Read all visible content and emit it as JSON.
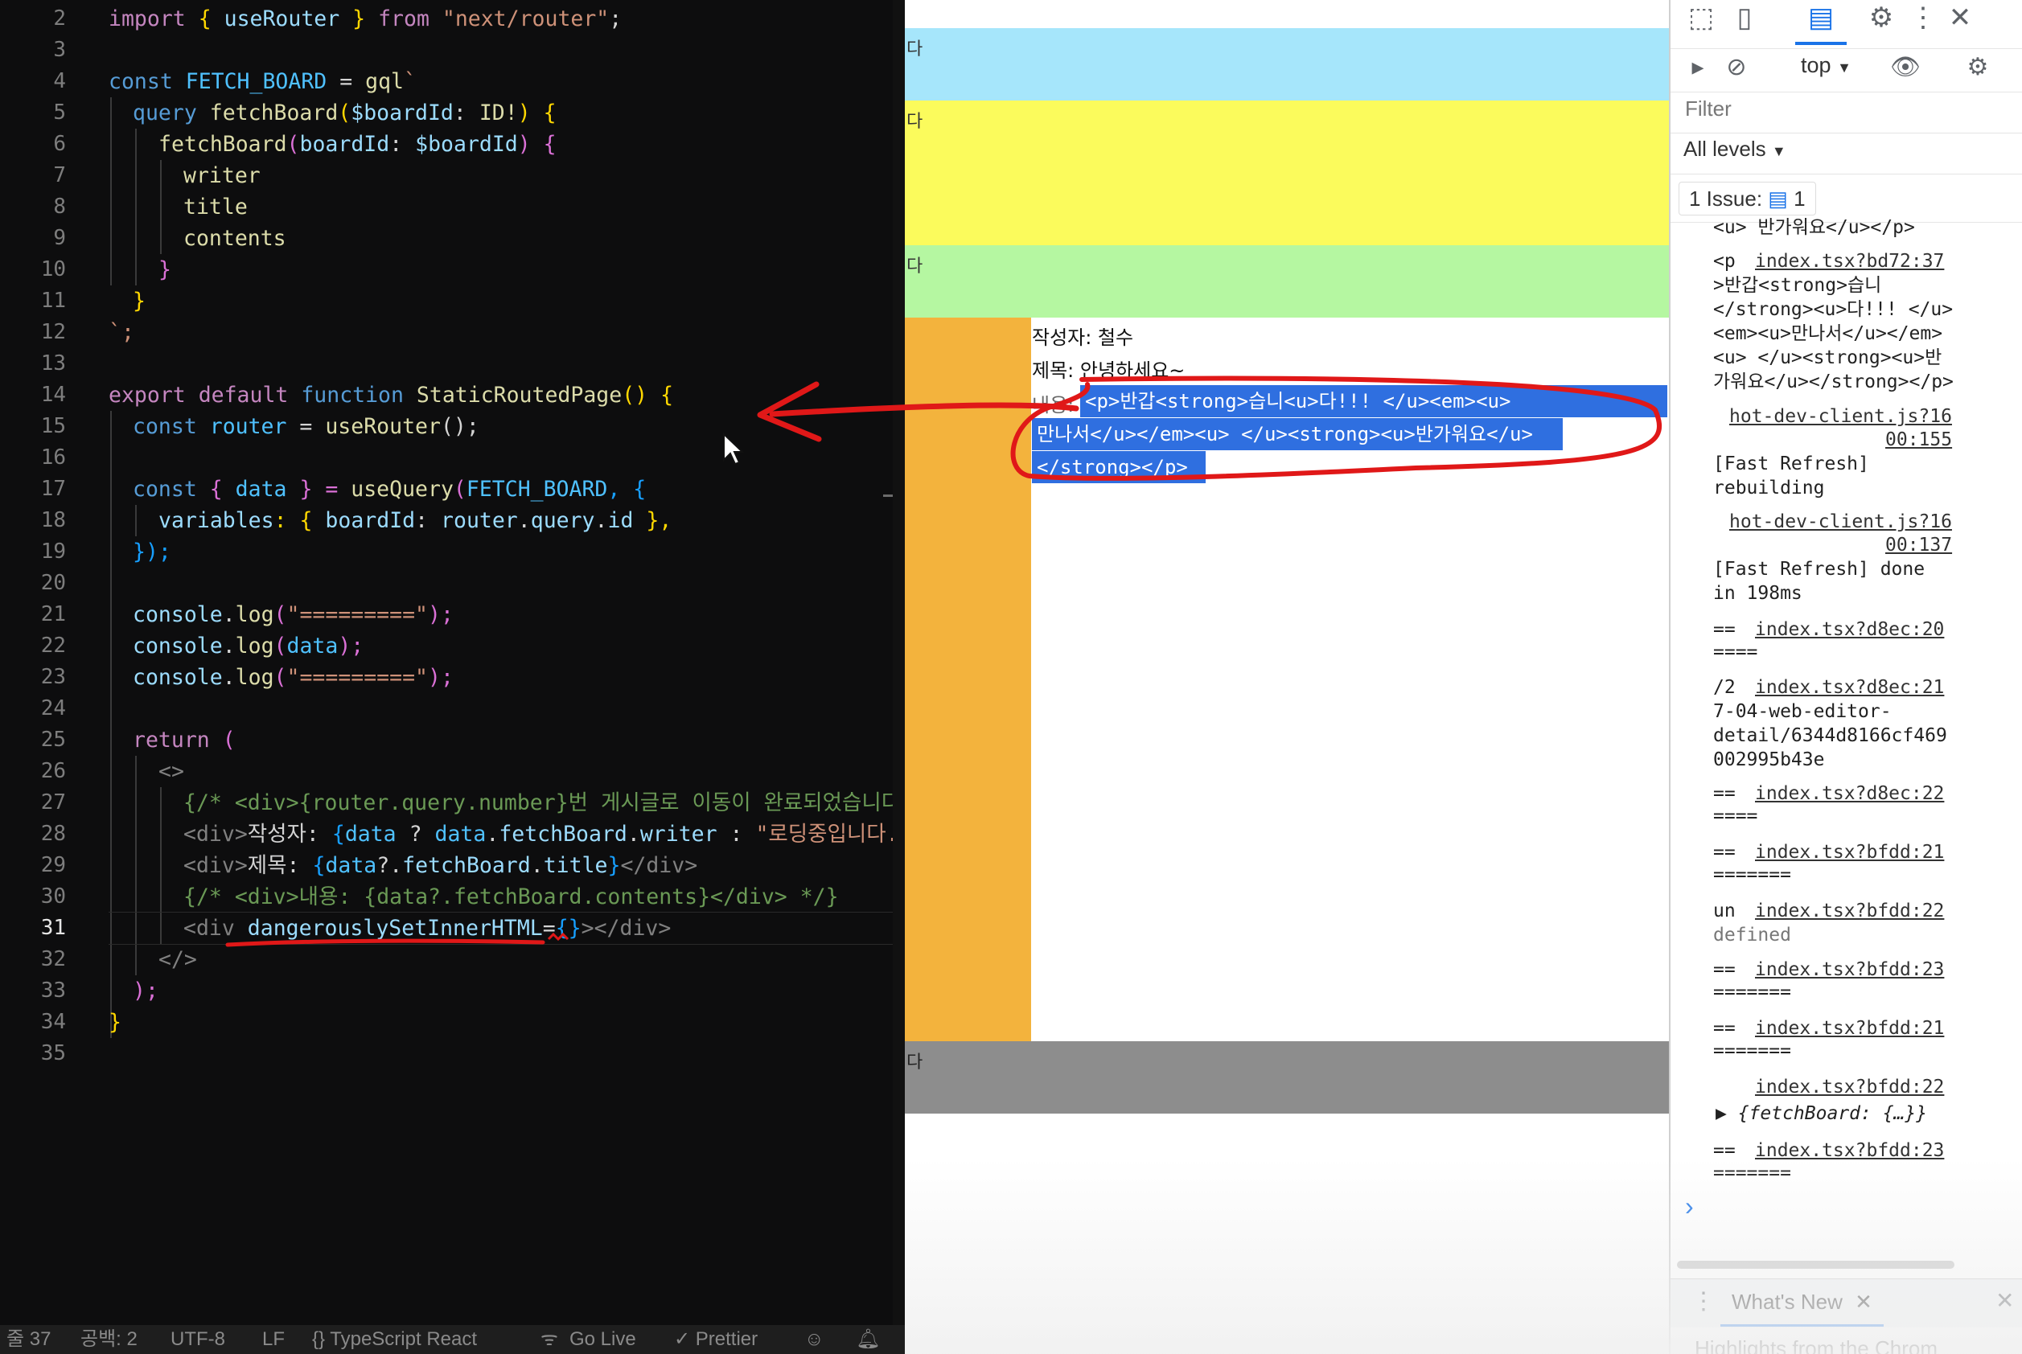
{
  "editor": {
    "line_numbers": [
      "2",
      "3",
      "4",
      "5",
      "6",
      "7",
      "8",
      "9",
      "10",
      "11",
      "12",
      "13",
      "14",
      "15",
      "16",
      "17",
      "18",
      "19",
      "20",
      "21",
      "22",
      "23",
      "24",
      "25",
      "26",
      "27",
      "28",
      "29",
      "30",
      "31",
      "32",
      "33",
      "34",
      "35"
    ],
    "lines": {
      "l2_a": "import ",
      "l2_b": "{ ",
      "l2_c": "useRouter",
      "l2_d": " } ",
      "l2_e": "from ",
      "l2_f": "\"next/router\"",
      "l2_g": ";",
      "l4_a": "const ",
      "l4_b": "FETCH_BOARD",
      "l4_c": " = ",
      "l4_d": "gql",
      "l4_e": "`",
      "l5_a": "query ",
      "l5_b": "fetchBoard",
      "l5_c": "(",
      "l5_d": "$boardId",
      "l5_e": ": ",
      "l5_f": "ID!",
      "l5_g": ") {",
      "l6_a": "fetchBoard",
      "l6_b": "(",
      "l6_c": "boardId",
      "l6_d": ": ",
      "l6_e": "$boardId",
      "l6_f": ") {",
      "l7": "writer",
      "l8": "title",
      "l9": "contents",
      "l10": "}",
      "l11": "}",
      "l12": "`;",
      "l14_a": "export ",
      "l14_b": "default ",
      "l14_c": "function ",
      "l14_d": "StaticRoutedPage",
      "l14_e": "() {",
      "l15_a": "const ",
      "l15_b": "router",
      "l15_c": " = ",
      "l15_d": "useRouter",
      "l15_e": "();",
      "l17_a": "const ",
      "l17_b": "{ ",
      "l17_c": "data",
      "l17_d": " } = ",
      "l17_e": "useQuery",
      "l17_f": "(",
      "l17_g": "FETCH_BOARD",
      "l17_h": ", {",
      "l18_a": "variables",
      "l18_b": ": { ",
      "l18_c": "boardId",
      "l18_d": ": ",
      "l18_e": "router",
      "l18_f": ".",
      "l18_g": "query",
      "l18_h": ".",
      "l18_i": "id",
      "l18_j": " },",
      "l19": "});",
      "l21_a": "console",
      "l21_b": ".",
      "l21_c": "log",
      "l21_d": "(",
      "l21_e": "\"=========\"",
      "l21_f": ");",
      "l22_a": "console",
      "l22_b": ".",
      "l22_c": "log",
      "l22_d": "(",
      "l22_e": "data",
      "l22_f": ");",
      "l23_a": "console",
      "l23_b": ".",
      "l23_c": "log",
      "l23_d": "(",
      "l23_e": "\"=========\"",
      "l23_f": ");",
      "l25_a": "return ",
      "l25_b": "(",
      "l26": "<>",
      "l27": "{/* <div>{router.query.number}번 게시글로 이동이 완료되었습니다.</",
      "l28_a": "<div>",
      "l28_b": "작성자: ",
      "l28_c": "{",
      "l28_d": "data",
      "l28_e": " ? ",
      "l28_f": "data",
      "l28_g": ".",
      "l28_h": "fetchBoard",
      "l28_i": ".",
      "l28_j": "writer",
      "l28_k": " : ",
      "l28_l": "\"로딩중입니다...\"",
      "l29_a": "<div>",
      "l29_b": "제목: ",
      "l29_c": "{",
      "l29_d": "data",
      "l29_e": "?.",
      "l29_f": "fetchBoard",
      "l29_g": ".",
      "l29_h": "title",
      "l29_i": "}",
      "l29_j": "</div>",
      "l30": "{/* <div>내용: {data?.fetchBoard.contents}</div> */}",
      "l31_a": "<div ",
      "l31_b": "dangerouslySetInnerHTML",
      "l31_c": "=",
      "l31_d": "{}",
      "l31_e": "></div>",
      "l32": "</>",
      "l33": ");",
      "l34": "}"
    }
  },
  "statusbar": {
    "line_col": "줄 37",
    "spaces": "공백: 2",
    "encoding": "UTF-8",
    "eol": "LF",
    "language": "{} TypeScript React",
    "golive": "Go Live",
    "prettier": "✓ Prettier"
  },
  "browser": {
    "band_label": "다",
    "writer": "작성자: 철수",
    "title": "제목: 안녕하세요~",
    "contents_label": "내용:",
    "contents_line1": "<p>반갑<strong>습니<u>다!!! </u><em><u>",
    "contents_line2": "만나서</u></em><u> </u><strong><u>반가워요</u>",
    "contents_line3": "</strong></p>",
    "band_colors": {
      "blue": "#a6e6fb",
      "yellow": "#fbfb5c",
      "green": "#b5f7a1",
      "orange": "#f3b33d",
      "gray": "#8d8d8d"
    }
  },
  "devtools": {
    "context": "top",
    "filter_placeholder": "Filter",
    "levels": "All levels",
    "issues": "1 Issue:",
    "issues_count": "1",
    "logs": [
      {
        "text": "<u> 반가워요</u></p>"
      },
      {
        "pre": "<p",
        "link": "index.tsx?bd72:37",
        "text": ">반갑<strong>습니\n</strong><u>다!!! </u>\n<em><u>만나서</u></em>\n<u> </u><strong><u>반\n가워요</u></strong></p>"
      },
      {
        "link": "hot-dev-client.js?16",
        "link2": "00:155",
        "text": "[Fast Refresh]\nrebuilding"
      },
      {
        "link": "hot-dev-client.js?16",
        "link2": "00:137",
        "text": "[Fast Refresh] done\nin 198ms"
      },
      {
        "pre": "==",
        "link": "index.tsx?d8ec:20",
        "text": "===="
      },
      {
        "pre": "/2",
        "link": "index.tsx?d8ec:21",
        "text": "7-04-web-editor-\ndetail/6344d8166cf469\n002995b43e"
      },
      {
        "pre": "==",
        "link": "index.tsx?d8ec:22",
        "text": "===="
      },
      {
        "pre": "==",
        "link": "index.tsx?bfdd:21",
        "text": "======="
      },
      {
        "pre": "un",
        "link": "index.tsx?bfdd:22",
        "text": "defined"
      },
      {
        "pre": "==",
        "link": "index.tsx?bfdd:23",
        "text": "======="
      },
      {
        "pre": "==",
        "link": "index.tsx?bfdd:21",
        "text": "======="
      },
      {
        "pre": "",
        "link": "index.tsx?bfdd:22",
        "text": "▶ {fetchBoard: {…}}"
      },
      {
        "pre": "==",
        "link": "index.tsx?bfdd:23",
        "text": "======="
      }
    ],
    "prompt": "›",
    "drawer_tab": "What's New",
    "drawer_text": "Highlights from the Chrom"
  },
  "colors": {
    "annotation_red": "#e01818",
    "selection_blue": "#2f6fe0",
    "link_blue": "#1a73e8"
  }
}
